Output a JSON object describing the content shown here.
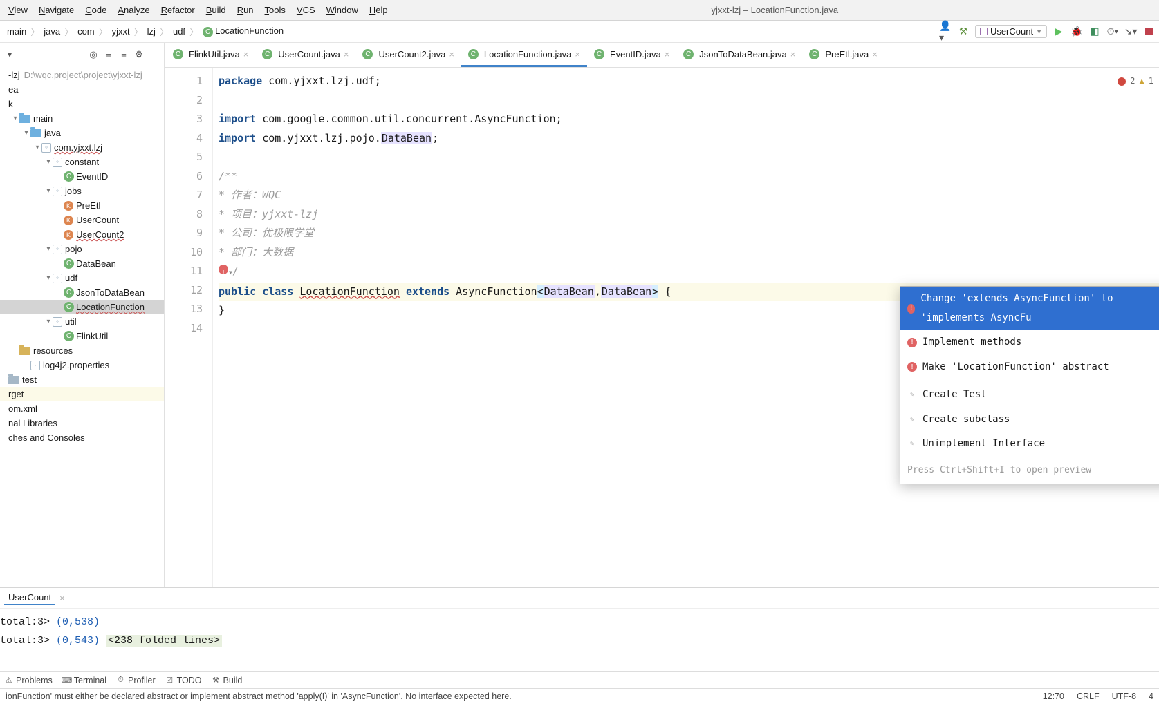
{
  "window": {
    "title": "yjxxt-lzj – LocationFunction.java"
  },
  "menu": {
    "items": [
      "View",
      "Navigate",
      "Code",
      "Analyze",
      "Refactor",
      "Build",
      "Run",
      "Tools",
      "VCS",
      "Window",
      "Help"
    ]
  },
  "breadcrumbs": [
    "main",
    "java",
    "com",
    "yjxxt",
    "lzj",
    "udf",
    "LocationFunction"
  ],
  "run_config": "UserCount",
  "tree": {
    "root": {
      "name": "-lzj",
      "path": "D:\\wqc.project\\project\\yjxxt-lzj"
    },
    "rows": [
      {
        "ind": 0,
        "type": "proj",
        "label": "-lzj",
        "suffix": "D:\\wqc.project\\project\\yjxxt-lzj"
      },
      {
        "ind": 0,
        "type": "plain",
        "label": "ea"
      },
      {
        "ind": 0,
        "type": "plain",
        "label": "k"
      },
      {
        "ind": 1,
        "type": "dir-src",
        "tw": "v",
        "label": "main"
      },
      {
        "ind": 2,
        "type": "dir-src",
        "tw": "v",
        "label": "java"
      },
      {
        "ind": 3,
        "type": "pkg",
        "tw": "v",
        "label": "com.yjxxt.lzj",
        "red": true
      },
      {
        "ind": 4,
        "type": "pkg",
        "tw": "v",
        "label": "constant"
      },
      {
        "ind": 5,
        "type": "cls",
        "label": "EventID"
      },
      {
        "ind": 4,
        "type": "pkg",
        "tw": "v",
        "label": "jobs"
      },
      {
        "ind": 5,
        "type": "kot",
        "label": "PreEtl"
      },
      {
        "ind": 5,
        "type": "kot",
        "label": "UserCount"
      },
      {
        "ind": 5,
        "type": "kot",
        "label": "UserCount2",
        "red": true
      },
      {
        "ind": 4,
        "type": "pkg",
        "tw": "v",
        "label": "pojo"
      },
      {
        "ind": 5,
        "type": "cls",
        "label": "DataBean"
      },
      {
        "ind": 4,
        "type": "pkg",
        "tw": "v",
        "label": "udf"
      },
      {
        "ind": 5,
        "type": "cls",
        "label": "JsonToDataBean"
      },
      {
        "ind": 5,
        "type": "cls",
        "label": "LocationFunction",
        "red": true,
        "sel": true
      },
      {
        "ind": 4,
        "type": "pkg",
        "tw": "v",
        "label": "util"
      },
      {
        "ind": 5,
        "type": "cls",
        "label": "FlinkUtil"
      },
      {
        "ind": 1,
        "type": "dir-res",
        "label": "resources"
      },
      {
        "ind": 2,
        "type": "file",
        "label": "log4j2.properties"
      },
      {
        "ind": 0,
        "type": "dir",
        "label": "test"
      },
      {
        "ind": 0,
        "type": "plain",
        "label": "rget",
        "hl": true
      },
      {
        "ind": 0,
        "type": "plain",
        "label": "om.xml"
      },
      {
        "ind": 0,
        "type": "plain",
        "label": "nal Libraries"
      },
      {
        "ind": 0,
        "type": "plain",
        "label": "ches and Consoles"
      }
    ]
  },
  "tabs": [
    "FlinkUtil.java",
    "UserCount.java",
    "UserCount2.java",
    "LocationFunction.java",
    "EventID.java",
    "JsonToDataBean.java",
    "PreEtl.java"
  ],
  "active_tab": 3,
  "gutter_lines": [
    "1",
    "2",
    "3",
    "4",
    "5",
    "6",
    "7",
    "8",
    "9",
    "10",
    "11",
    "12",
    "13",
    "14"
  ],
  "code": {
    "l1": {
      "kw": "package",
      "rest": " com.yjxxt.lzj.udf;"
    },
    "l3": {
      "kw": "import",
      "rest": " com.google.common.util.concurrent.AsyncFunction;"
    },
    "l4": {
      "kw": "import",
      "pre": " com.yjxxt.lzj.pojo.",
      "hl": "DataBean",
      "post": ";"
    },
    "l6": "/**",
    "l7": " * 作者：WQC",
    "l8": " * 项目：yjxxt-lzj",
    "l9": " * 公司：优极限学堂",
    "l10": " * 部门：大数据",
    "l11": "/",
    "l12": {
      "kw1": "public",
      "kw2": "class",
      "cname": "LocationFunction",
      "kw3": "extends",
      "ext": "AsyncFunction",
      "g1": "<",
      "t1": "DataBean",
      "c": ",",
      "t2": "DataBean",
      "g2": ">",
      "b": " {"
    },
    "l13": "}"
  },
  "popup": {
    "items": [
      {
        "kind": "err",
        "label": "Change 'extends AsyncFunction' to 'implements AsyncFu",
        "sel": true
      },
      {
        "kind": "err",
        "label": "Implement methods"
      },
      {
        "kind": "err",
        "label": "Make 'LocationFunction' abstract"
      },
      {
        "sep": true
      },
      {
        "kind": "g",
        "label": "Create Test"
      },
      {
        "kind": "g",
        "label": "Create subclass"
      },
      {
        "kind": "g",
        "label": "Unimplement Interface"
      }
    ],
    "hint": "Press Ctrl+Shift+I to open preview"
  },
  "errors": {
    "err": "2",
    "warn": "1"
  },
  "run": {
    "tab": "UserCount",
    "out1_pre": "total:3>",
    "out1_val": " (0,538)",
    "out2_pre": "total:3>",
    "out2_val": " (0,543) ",
    "fold": "<238 folded lines>"
  },
  "bottom": [
    "Problems",
    "Terminal",
    "Profiler",
    "TODO",
    "Build"
  ],
  "status": {
    "msg": "ionFunction' must either be declared abstract or implement abstract method 'apply(I)' in 'AsyncFunction'. No interface expected here.",
    "pos": "12:70",
    "le": "CRLF",
    "enc": "UTF-8",
    "ind": "4"
  }
}
